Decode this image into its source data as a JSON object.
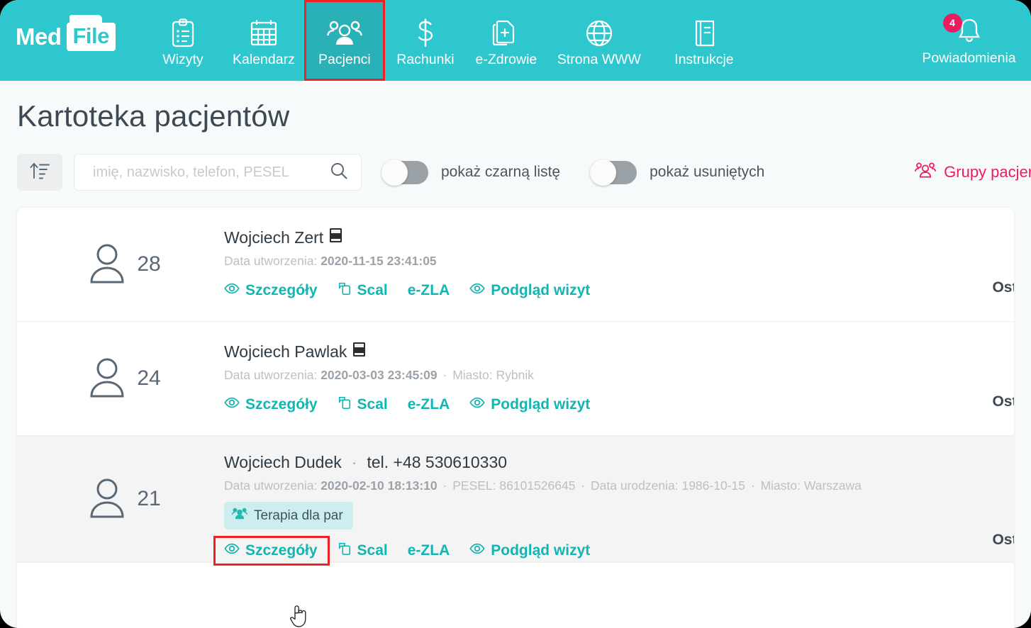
{
  "brand": {
    "med": "Med",
    "file": "File"
  },
  "nav": {
    "items": [
      {
        "label": "Wizyty",
        "icon": "clipboard-icon",
        "active": false
      },
      {
        "label": "Kalendarz",
        "icon": "calendar-icon",
        "active": false
      },
      {
        "label": "Pacjenci",
        "icon": "patients-icon",
        "active": true
      },
      {
        "label": "Rachunki",
        "icon": "dollar-icon",
        "active": false
      },
      {
        "label": "e-Zdrowie",
        "icon": "e-health-icon",
        "active": false
      },
      {
        "label": "Strona WWW",
        "icon": "globe-icon",
        "active": false
      },
      {
        "label": "Instrukcje",
        "icon": "book-icon",
        "active": false
      }
    ],
    "notifications": {
      "label": "Powiadomienia",
      "badge": "4",
      "icon": "bell-icon"
    },
    "active_outline_color": "#ee2222",
    "bar_color": "#2ec7ce",
    "active_bg_color": "#2ab0b7"
  },
  "page": {
    "title": "Kartoteka pacjentów"
  },
  "toolbar": {
    "sort_icon": "sort-ascending-icon",
    "search": {
      "placeholder": "imię, nazwisko, telefon, PESEL",
      "value": "",
      "icon": "search-icon"
    },
    "toggles": [
      {
        "label": "pokaż czarną listę",
        "on": false
      },
      {
        "label": "pokaż usuniętych",
        "on": false
      }
    ],
    "groups_link": {
      "label": "Grupy pacjen",
      "icon": "patients-icon",
      "color": "#ef1a62"
    }
  },
  "list": {
    "last_visit_label": "Ostatnia wiz",
    "rows": [
      {
        "count": "28",
        "name": "Wojciech Zert",
        "has_book_icon": true,
        "phone": "",
        "created_label": "Data utworzenia:",
        "created_value": "2020-11-15 23:41:05",
        "pesel_label": "",
        "pesel_value": "",
        "birth_label": "",
        "birth_value": "",
        "city_label": "",
        "city_value": "",
        "tag": "",
        "highlighted": false,
        "alt_bg": false,
        "actions": [
          "Szczegóły",
          "Scal",
          "e-ZLA",
          "Podgląd wizyt"
        ]
      },
      {
        "count": "24",
        "name": "Wojciech Pawlak",
        "has_book_icon": true,
        "phone": "",
        "created_label": "Data utworzenia:",
        "created_value": "2020-03-03 23:45:09",
        "pesel_label": "",
        "pesel_value": "",
        "birth_label": "",
        "birth_value": "",
        "city_label": "Miasto:",
        "city_value": "Rybnik",
        "tag": "",
        "highlighted": false,
        "alt_bg": false,
        "actions": [
          "Szczegóły",
          "Scal",
          "e-ZLA",
          "Podgląd wizyt"
        ]
      },
      {
        "count": "21",
        "name": "Wojciech Dudek",
        "has_book_icon": false,
        "phone": "tel. +48 530610330",
        "created_label": "Data utworzenia:",
        "created_value": "2020-02-10 18:13:10",
        "pesel_label": "PESEL:",
        "pesel_value": "86101526645",
        "birth_label": "Data urodzenia:",
        "birth_value": "1986-10-15",
        "city_label": "Miasto:",
        "city_value": "Warszawa",
        "tag": "Terapia dla par",
        "highlighted": true,
        "alt_bg": true,
        "actions": [
          "Szczegóły",
          "Scal",
          "e-ZLA",
          "Podgląd wizyt"
        ]
      }
    ],
    "action_icons": {
      "Szczegóły": "eye-icon",
      "Scal": "merge-copy-icon",
      "e-ZLA": "",
      "Podgląd wizyt": "eye-icon"
    }
  },
  "cursor": {
    "type": "pointer-hand-cursor"
  }
}
